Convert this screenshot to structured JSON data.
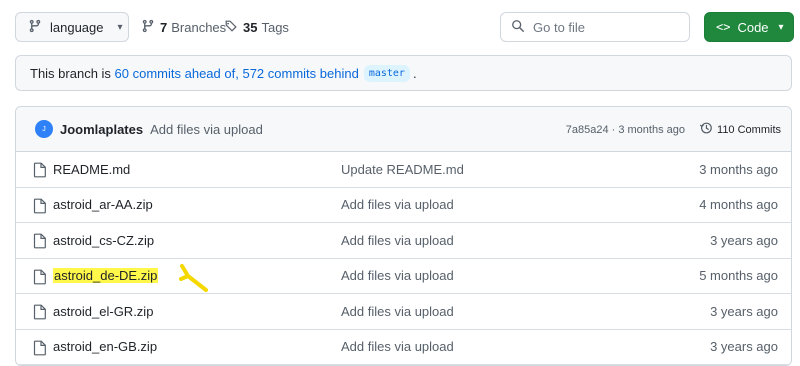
{
  "topbar": {
    "branch_label": "language",
    "branches_count": "7",
    "branches_label": "Branches",
    "tags_count": "35",
    "tags_label": "Tags",
    "search_placeholder": "Go to file",
    "code_label": "Code"
  },
  "banner": {
    "prefix": "This branch is",
    "ahead": "60 commits ahead of,",
    "behind": "572 commits behind",
    "base_branch": "master",
    "suffix": "."
  },
  "latest_commit": {
    "avatar_text": "J",
    "author": "Joomlaplates",
    "message": "Add files via upload",
    "hash_time": "7a85a24 · 3 months ago",
    "commit_count": "110 Commits"
  },
  "files": [
    {
      "name": "README.md",
      "message": "Update README.md",
      "age": "3 months ago",
      "highlight": false
    },
    {
      "name": "astroid_ar-AA.zip",
      "message": "Add files via upload",
      "age": "4 months ago",
      "highlight": false
    },
    {
      "name": "astroid_cs-CZ.zip",
      "message": "Add files via upload",
      "age": "3 years ago",
      "highlight": false
    },
    {
      "name": "astroid_de-DE.zip",
      "message": "Add files via upload",
      "age": "5 months ago",
      "highlight": true
    },
    {
      "name": "astroid_el-GR.zip",
      "message": "Add files via upload",
      "age": "3 years ago",
      "highlight": false
    },
    {
      "name": "astroid_en-GB.zip",
      "message": "Add files via upload",
      "age": "3 years ago",
      "highlight": false
    }
  ],
  "colors": {
    "accent_link": "#0969da",
    "code_button": "#1f883d",
    "highlight": "#fff84a",
    "annotation_marker": "#f5d800"
  },
  "icons": {
    "branch": "git-branch-icon",
    "tag": "tag-icon",
    "search": "search-icon",
    "code": "code-icon",
    "history": "history-icon",
    "file": "file-icon"
  }
}
